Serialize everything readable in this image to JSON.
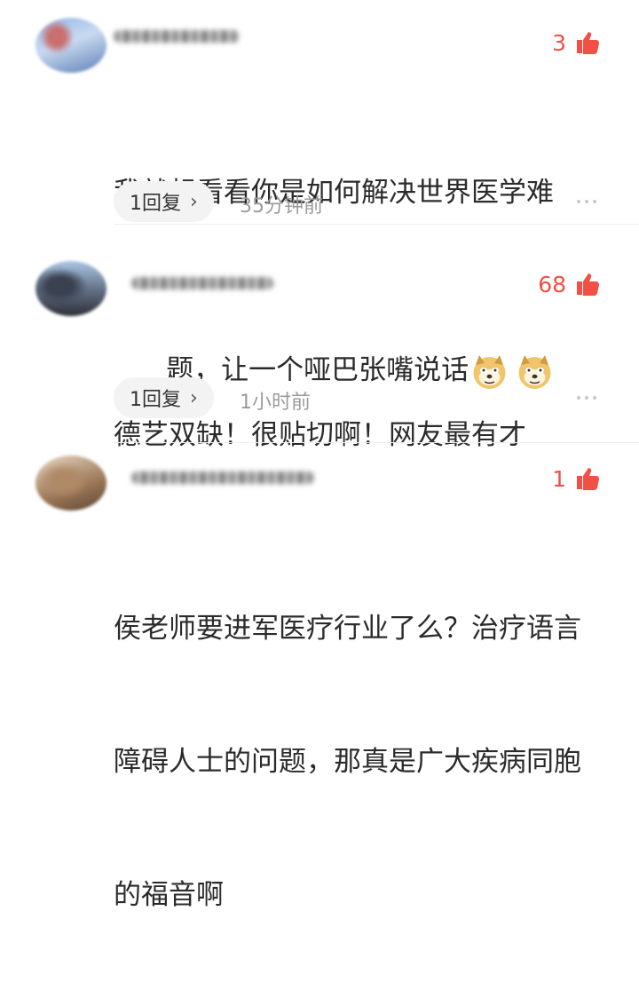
{
  "comments": [
    {
      "likes": "3",
      "text_lines": [
        "我就想看看你是如何解决世界医学难",
        "题，让一个哑巴张嘴说话"
      ],
      "emoji": [
        "doge-emoji",
        "doge-emoji"
      ],
      "reply_label": "1回复",
      "time": "35分钟前"
    },
    {
      "likes": "68",
      "text_lines": [
        "德艺双缺！很贴切啊！网友最有才"
      ],
      "reply_label": "1回复",
      "time": "1小时前"
    },
    {
      "likes": "1",
      "text_lines": [
        "侯老师要进军医疗行业了么？治疗语言",
        "障碍人士的问题，那真是广大疾病同胞",
        "的福音啊"
      ]
    }
  ],
  "icons": {
    "like": "thumbs-up-icon",
    "reply_chevron": "chevron-right-icon",
    "more": "ellipsis-icon"
  },
  "colors": {
    "like_accent": "#f24f45",
    "reply_bg": "#f3f3f3",
    "meta_text": "#9b9b9b"
  }
}
